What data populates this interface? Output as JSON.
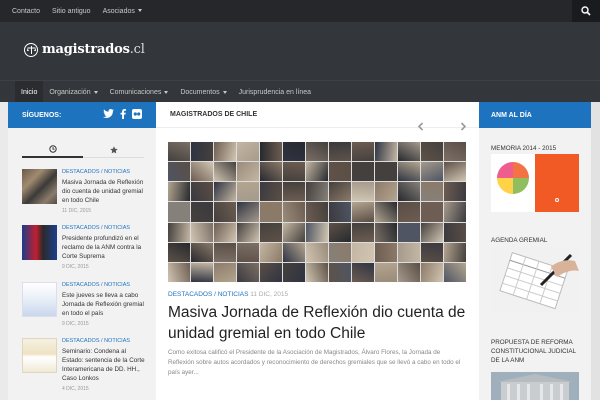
{
  "topbar": {
    "links": [
      "Contacto",
      "Sitio antiguo",
      "Asociados"
    ],
    "search_icon": "search-icon"
  },
  "header": {
    "logo_name": "magistrados",
    "logo_tld": ".cl"
  },
  "nav": {
    "items": [
      "Inicio",
      "Organización",
      "Comunicaciones",
      "Documentos",
      "Jurisprudencia en línea"
    ]
  },
  "left": {
    "heading": "SÍGUENOS:",
    "social_icons": [
      "twitter-icon",
      "facebook-icon",
      "flickr-icon"
    ],
    "tabs": [
      "clock-icon",
      "star-icon"
    ],
    "posts": [
      {
        "category": "DESTACADOS / NOTICIAS",
        "title": "Masiva Jornada de Reflexión dio cuenta de unidad gremial en todo Chile",
        "date": "11 DIC, 2015"
      },
      {
        "category": "DESTACADOS / NOTICIAS",
        "title": "Presidente profundizó en el reclamo de la ANM contra la Corte Suprema",
        "date": "9 DIC, 2015"
      },
      {
        "category": "DESTACADOS / NOTICIAS",
        "title": "Este jueves se lleva a cabo Jornada de Reflexión gremial en todo el país",
        "date": "9 DIC, 2015"
      },
      {
        "category": "DESTACADOS / NOTICIAS",
        "title": "Seminario: Condena al Estado: sentencia de la Corte Interamericana de DD. HH., Caso Lonkos",
        "date": "4 DIC, 2015"
      }
    ]
  },
  "center": {
    "heading": "MAGISTRADOS DE CHILE",
    "featured": {
      "category": "DESTACADOS / NOTICIAS",
      "date": "11 DIC, 2015",
      "title": "Masiva Jornada de Reflexión dio cuenta de unidad gremial en todo Chile",
      "excerpt": "Como exitosa calificó el Presidente de la Asociación de Magistrados, Álvaro Flores, la Jornada de Reflexión sobre autos acordados y reconocimiento de derechos gremiales que se llevó a cabo en todo el país ayer..."
    }
  },
  "right": {
    "heading": "ANM AL DÍA",
    "widgets": [
      "MEMORIA 2014 - 2015",
      "AGENDA GREMIAL",
      "PROPUESTA DE REFORMA CONSTITUCIONAL JUDICIAL DE LA ANM"
    ]
  },
  "colors": {
    "accent": "#1e73be",
    "topbar": "#26272b",
    "header": "#33363b",
    "memo_orange": "#f15a24"
  }
}
